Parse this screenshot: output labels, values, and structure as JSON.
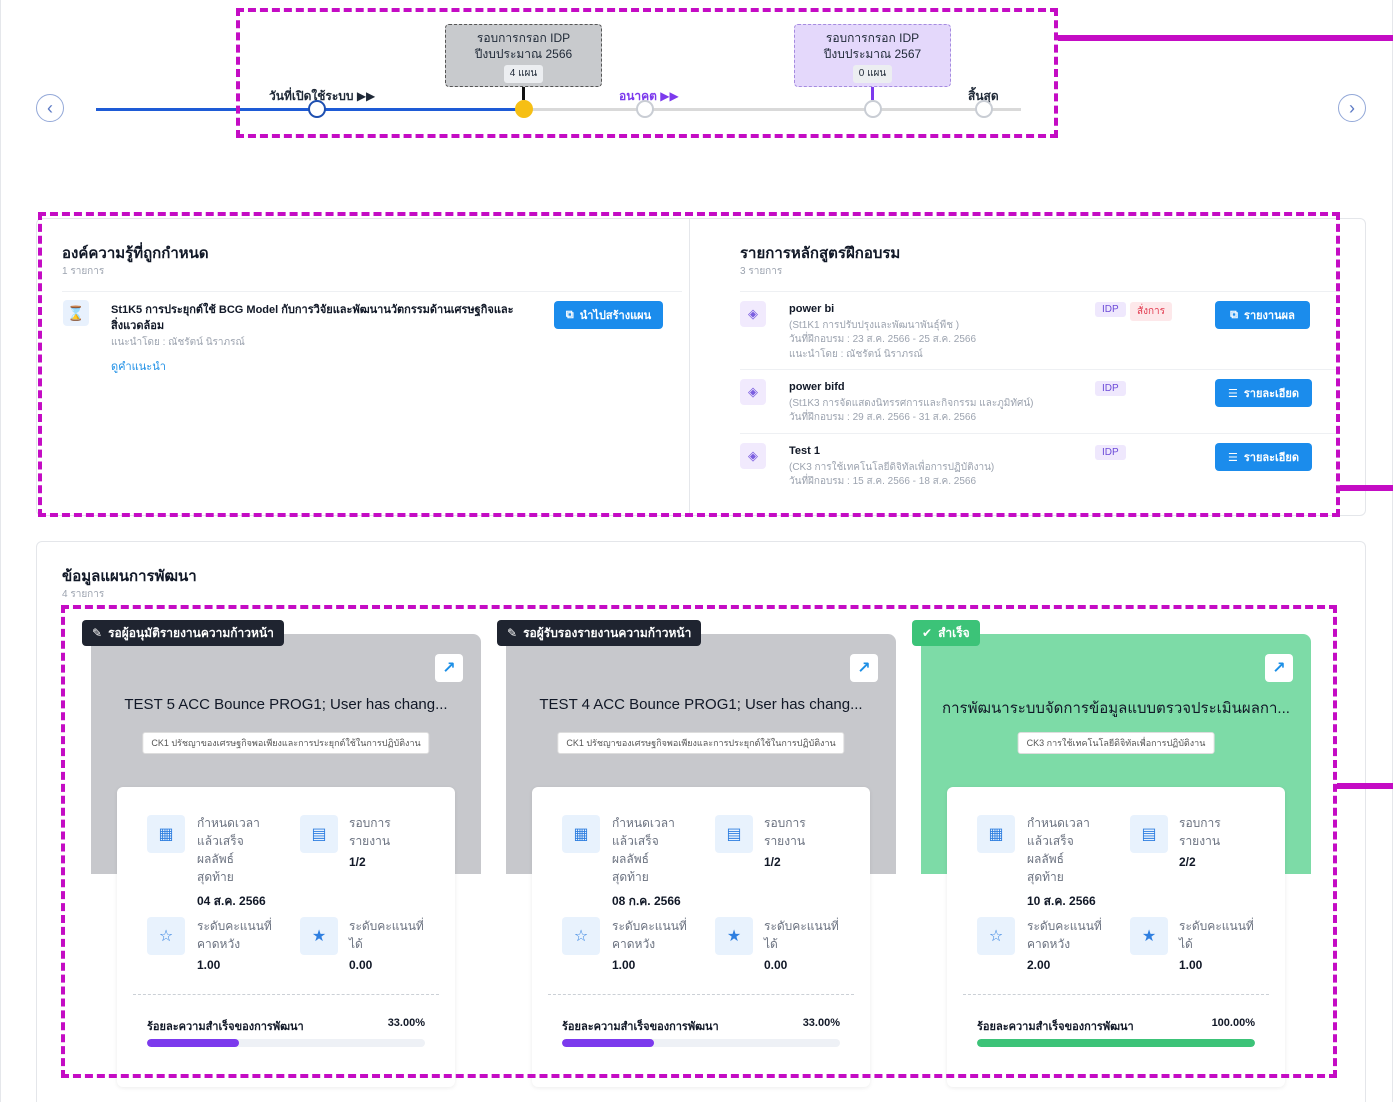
{
  "timeline": {
    "prev_icon": "chevron-left-icon",
    "next_icon": "chevron-right-icon",
    "start_label": "วันที่เปิดใช้ระบบ ▶▶",
    "future_label": "อนาคต ▶▶",
    "end_label": "สิ้นสุด",
    "box_2566": {
      "line1": "รอบการกรอก IDP",
      "line2": "ปีงบประมาณ 2566",
      "count": "4 แผน"
    },
    "box_2567": {
      "line1": "รอบการกรอก IDP",
      "line2": "ปีงบประมาณ 2567",
      "count": "0 แผน"
    },
    "colors": {
      "done": "#1e5bd6",
      "current": "#f6bf14",
      "future": "#7c3aed"
    }
  },
  "knowledge": {
    "title": "องค์ความรู้ที่ถูกกำหนด",
    "count": "1 รายการ",
    "item": {
      "icon": "hourglass-icon",
      "name": "St1K5 การประยุกต์ใช้ BCG Model กับการวิจัยและพัฒนานวัตกรรมด้านเศรษฐกิจและสิ่งแวดล้อม",
      "recommended_by": "แนะนำโดย : ณัชรัตน์ นิราภรณ์",
      "link": "ดูคำแนะนำ",
      "button": "นำไปสร้างแผน"
    }
  },
  "courses": {
    "title": "รายการหลักสูตรฝึกอบรม",
    "count": "3 รายการ",
    "items": [
      {
        "name": "power bi",
        "sub": "(St1K1 การปรับปรุงและพัฒนาพันธุ์พืช )",
        "date": "วันที่ฝึกอบรม : 23 ส.ค. 2566 - 25 ส.ค. 2566",
        "by": "แนะนำโดย : ณัชรัตน์ นิราภรณ์",
        "badge": "IDP",
        "badge2": "สั่งการ",
        "button": "รายงานผล"
      },
      {
        "name": "power bifd",
        "sub": "(St1K3 การจัดแสดงนิทรรศการและกิจกรรม และภูมิทัศน์)",
        "date": "วันที่ฝึกอบรม : 29 ส.ค. 2566 - 31 ส.ค. 2566",
        "badge": "IDP",
        "button": "รายละเอียด"
      },
      {
        "name": "Test 1",
        "sub": "(CK3 การใช้เทคโนโลยีดิจิทัลเพื่อการปฏิบัติงาน)",
        "date": "วันที่ฝึกอบรม : 15 ส.ค. 2566 - 18 ส.ค. 2566",
        "badge": "IDP",
        "button": "รายละเอียด"
      }
    ]
  },
  "plans": {
    "title": "ข้อมูลแผนการพัฒนา",
    "count": "4 รายการ",
    "labels": {
      "deadline": "กำหนดเวลาแล้วเสร็จผลลัพธ์สุดท้าย",
      "report_round": "รอบการรายงาน",
      "expected_score": "ระดับคะแนนที่คาดหวัง",
      "actual_score": "ระดับคะแนนที่ได้",
      "progress": "ร้อยละความสำเร็จของการพัฒนา"
    },
    "items": [
      {
        "status": "รอผู้อนุมัติรายงานความก้าวหน้า",
        "status_icon": "pencil-icon",
        "title": "TEST 5 ACC Bounce PROG1; User has chang...",
        "competency": "CK1 ปรัชญาของเศรษฐกิจพอเพียงและการประยุกต์ใช้ในการปฏิบัติงาน",
        "deadline": "04 ส.ค. 2566",
        "report": "1/2",
        "expected": "1.00",
        "actual": "0.00",
        "percent_text": "33.00%",
        "percent": 33,
        "theme": "gray",
        "bar_color": "#7c3aed"
      },
      {
        "status": "รอผู้รับรองรายงานความก้าวหน้า",
        "status_icon": "pencil-icon",
        "title": "TEST 4 ACC Bounce PROG1; User has chang...",
        "competency": "CK1 ปรัชญาของเศรษฐกิจพอเพียงและการประยุกต์ใช้ในการปฏิบัติงาน",
        "deadline": "08 ก.ค. 2566",
        "report": "1/2",
        "expected": "1.00",
        "actual": "0.00",
        "percent_text": "33.00%",
        "percent": 33,
        "theme": "gray",
        "bar_color": "#7c3aed"
      },
      {
        "status": "สำเร็จ",
        "status_icon": "check-circle-icon",
        "title": "การพัฒนาระบบจัดการข้อมูลแบบตรวจประเมินผลกา...",
        "competency": "CK3 การใช้เทคโนโลยีดิจิทัลเพื่อการปฏิบัติงาน",
        "deadline": "10 ส.ค. 2566",
        "report": "2/2",
        "expected": "2.00",
        "actual": "1.00",
        "percent_text": "100.00%",
        "percent": 100,
        "theme": "green",
        "bar_color": "#3cc378"
      }
    ]
  }
}
